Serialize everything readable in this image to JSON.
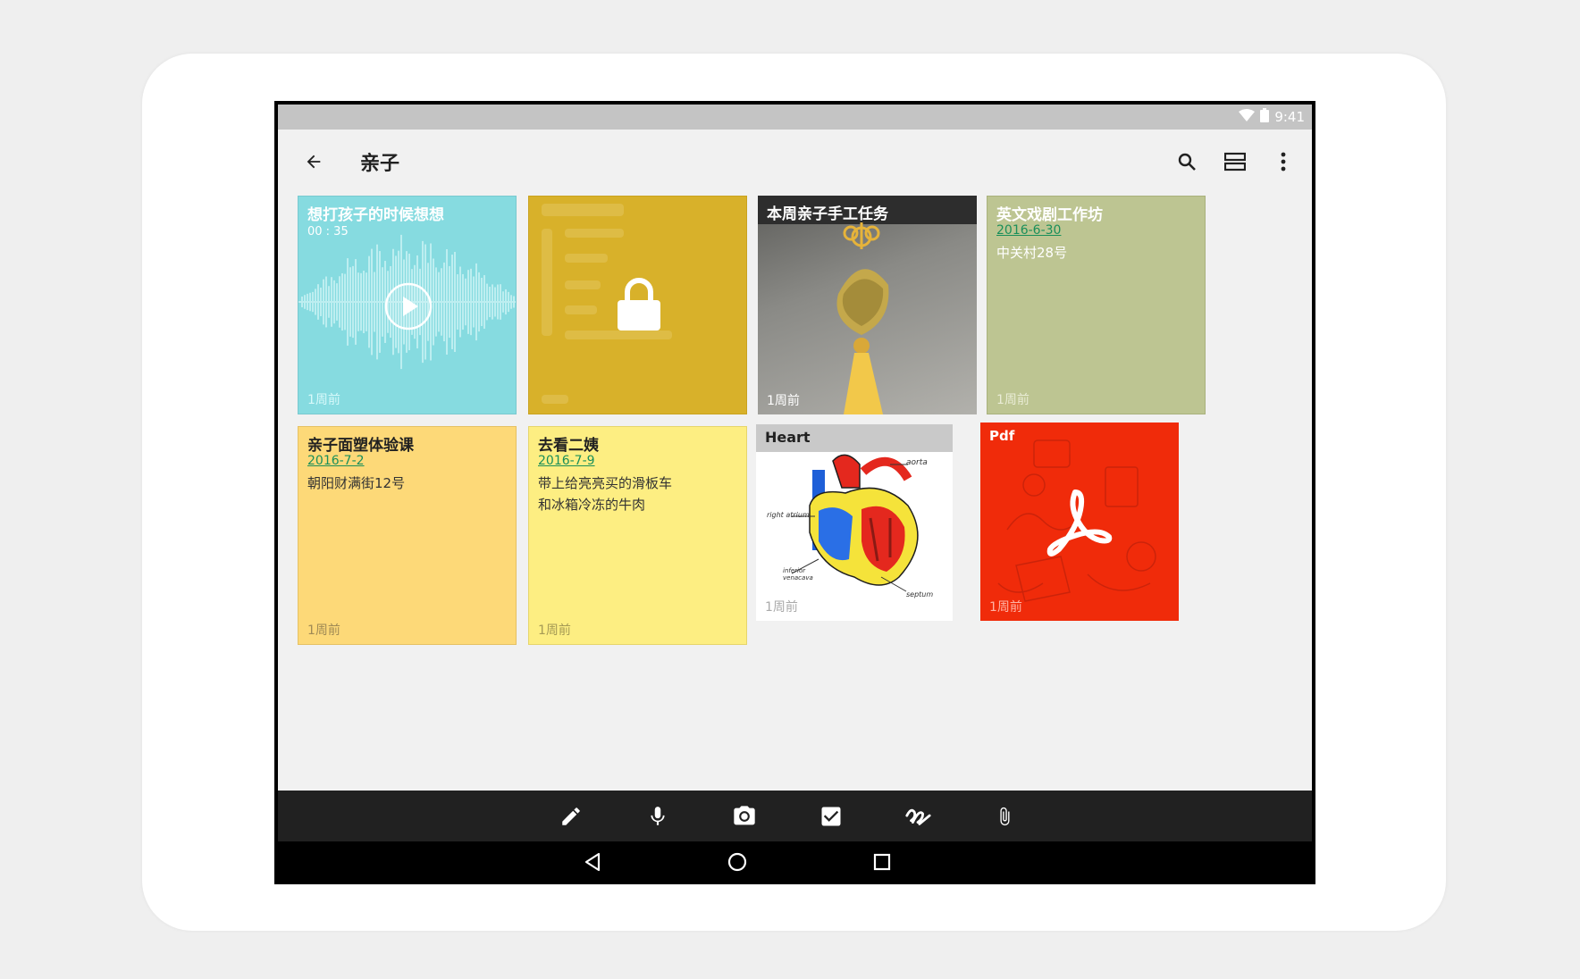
{
  "status": {
    "time": "9:41",
    "wifi_icon": "wifi-icon",
    "battery_icon": "battery-icon"
  },
  "appbar": {
    "title": "亲子",
    "back_icon": "arrow-back-icon",
    "search_icon": "search-icon",
    "view_icon": "list-view-icon",
    "more_icon": "more-vert-icon"
  },
  "cards": [
    {
      "type": "audio",
      "title": "想打孩子的时候想想",
      "duration": "00 : 35",
      "ago": "1周前",
      "color": "#86dbe0"
    },
    {
      "type": "locked",
      "ago": "",
      "color": "#d8b12a"
    },
    {
      "type": "image",
      "title": "本周亲子手工任务",
      "ago": "1周前"
    },
    {
      "type": "text",
      "title": "英文戏剧工作坊",
      "date": "2016-6-30",
      "lines": [
        "中关村28号"
      ],
      "ago": "1周前",
      "color": "#bdc592"
    },
    {
      "type": "text",
      "title": "亲子面塑体验课",
      "date": "2016-7-2",
      "lines": [
        "朝阳财满街12号"
      ],
      "ago": "1周前",
      "color": "#fdd978"
    },
    {
      "type": "text",
      "title": "去看二姨",
      "date": "2016-7-9",
      "lines": [
        "带上给亮亮买的滑板车",
        "和冰箱冷冻的牛肉"
      ],
      "ago": "1周前",
      "color": "#fdee82"
    },
    {
      "type": "image",
      "title": "Heart",
      "ago": "1周前",
      "labels": [
        "aorta",
        "right atrium",
        "inferior venacava",
        "septum"
      ]
    },
    {
      "type": "pdf",
      "title": "Pdf",
      "ago": "1周前",
      "color": "#f02b0a"
    }
  ],
  "toolbar": {
    "tools": [
      "pencil-icon",
      "microphone-icon",
      "camera-icon",
      "checkbox-icon",
      "handwriting-icon",
      "attachment-icon"
    ]
  },
  "navbar": {
    "back": "nav-back-icon",
    "home": "nav-home-icon",
    "recents": "nav-recents-icon"
  }
}
